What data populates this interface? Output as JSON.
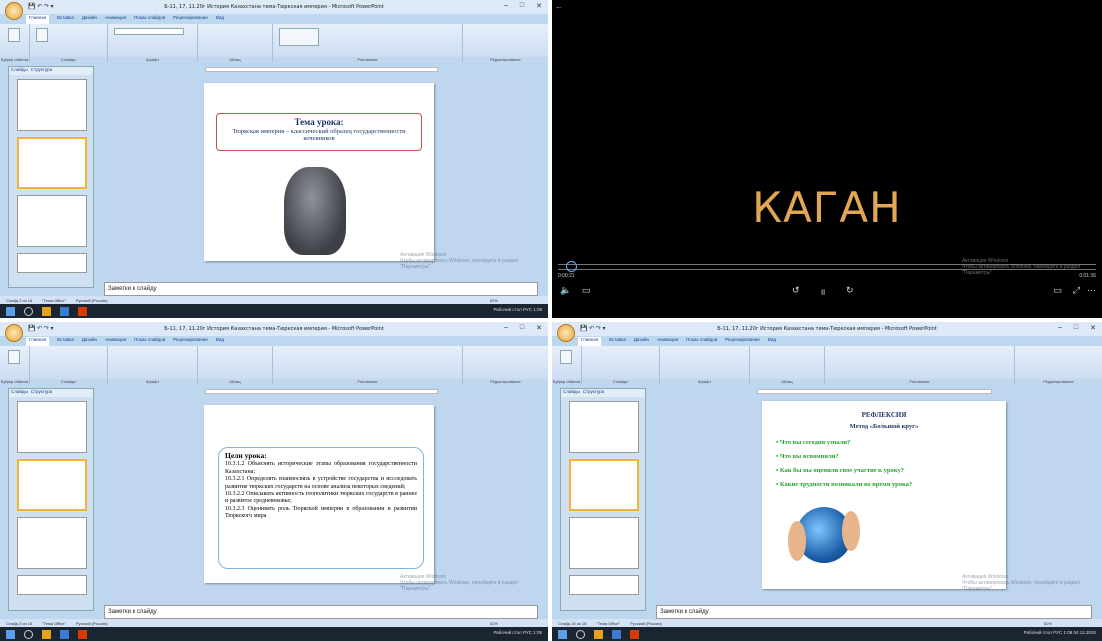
{
  "windows": [
    {
      "title": "Б-11, 17, 11.20г История Казахстана тема-Тюркская империя - Microsoft PowerPoint",
      "status_slide": "Слайд 2 из 18",
      "status_theme": "\"Тема Office\"",
      "status_lang": "Русский (Россия)",
      "zoom": "62%",
      "slide_title": "Тема урока:",
      "slide_subtitle": "Тюркская империя – классический образец государственности кочевников"
    },
    {
      "video_text": "КАГАН",
      "time_left": "0:00:21",
      "time_right": "0:01:36",
      "watermark_line1": "Активация Windows",
      "watermark_line2": "Чтобы активировать Windows, перейдите в раздел \"Параметры\"."
    },
    {
      "title": "Б-11, 17, 11.20г История Казахстана тема-Тюркская империя - Microsoft PowerPoint",
      "status_slide": "Слайд 3 из 18",
      "status_theme": "\"Тема Office\"",
      "status_lang": "Русский (Россия)",
      "zoom": "62%",
      "goals_heading": "Цели урока:",
      "goals": [
        "10.3.1.2 Объяснять исторические этапы образования государственности Казахстана;",
        "10.3.2.1 Определять взаимосвязь в устройстве государства и исследовать развитие тюркских государств на основе анализа некоторых сведений;",
        "10.3.2.2 Описывать активность геополитики тюркских государств в раннее и развитое средневековье;",
        "10.3.2.3 Оценивать роль Тюркской империи в образовании и развитии Тюркского мира"
      ]
    },
    {
      "title": "Б-11, 17, 11.20г История Казахстана тема-Тюркская империя - Microsoft PowerPoint",
      "status_slide": "Слайд 16 из 18",
      "status_theme": "\"Тема Office\"",
      "status_lang": "Русский (Россия)",
      "zoom": "62%",
      "slide_title": "РЕФЛЕКСИЯ",
      "slide_subtitle": "Метод «Большой круг»",
      "bullets": [
        "Что вы сегодня узнали?",
        "Что вы вспомнили?",
        "Как бы вы оценили свое участие к уроку?",
        "Какие трудности возникали во время урока?"
      ]
    }
  ],
  "common": {
    "tabs": [
      "Главная",
      "Вставка",
      "Дизайн",
      "Анимация",
      "Показ слайдов",
      "Рецензирование",
      "Вид"
    ],
    "pane_tabs": [
      "Слайды",
      "Структура"
    ],
    "notes": "Заметки к слайду",
    "watermark_line1": "Активация Windows",
    "watermark_line2": "Чтобы активировать Windows, перейдите в раздел \"Параметры\".",
    "ribbon_groups": [
      "Буфер обмена",
      "Слайды",
      "Шрифт",
      "Абзац",
      "Рисование",
      "Редактирование"
    ],
    "clock_time": "1:08",
    "clock_date": "04.12.2020",
    "lang": "РУС",
    "desktop": "Рабочий стол"
  }
}
